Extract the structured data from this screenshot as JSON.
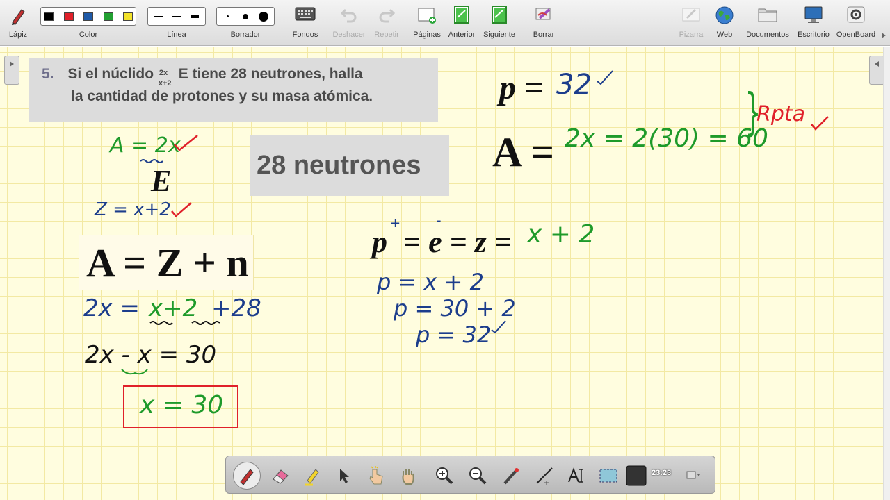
{
  "toolbar": {
    "pen": "Lápiz",
    "color": "Color",
    "line": "Línea",
    "eraser": "Borrador",
    "backgrounds": "Fondos",
    "undo": "Deshacer",
    "redo": "Repetir",
    "pages": "Páginas",
    "previous": "Anterior",
    "next": "Siguiente",
    "clear": "Borrar",
    "board": "Pizarra",
    "web": "Web",
    "documents": "Documentos",
    "desktop": "Escritorio",
    "app": "OpenBoard",
    "colors": [
      "#000000",
      "#e0202a",
      "#1f5aa8",
      "#22a032",
      "#f2e22a"
    ]
  },
  "problem": {
    "number": "5.",
    "line1a": "Si el núclido",
    "sup": "2x",
    "sub": "x+2",
    "line1b": "E tiene 28 neutrones, halla",
    "line2": "la cantidad de protones y su masa atómica."
  },
  "clip": {
    "text": "28 neutrones"
  },
  "left_work": {
    "a_eq": "A = 2x",
    "e": "E",
    "z_eq": "Z = x+2",
    "formula": "A = Z + n",
    "step1a": "2x =",
    "step1b": "x+2",
    "step1c": "+28",
    "step2": "2x - x = 30",
    "result": "x = 30"
  },
  "right_work": {
    "p_label": "p =",
    "p_value": "32",
    "a_label": "A =",
    "a_value": "2x = 2(30) = 60",
    "brace": "}",
    "note": "Rpta",
    "chain_a": "p",
    "chain_b": "= e = z =",
    "chain_val": "x + 2",
    "h1": "p = x + 2",
    "h2": "p = 30 + 2",
    "h3": "p = 32",
    "plus": "+",
    "minus": "-"
  },
  "bottom": {
    "time": "23:23"
  }
}
